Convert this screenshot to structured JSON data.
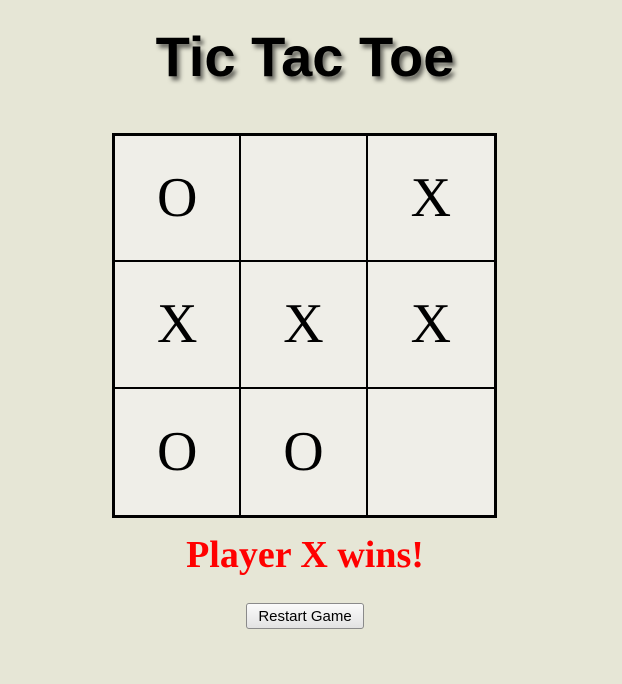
{
  "title": "Tic Tac Toe",
  "board": [
    [
      "O",
      "",
      "X"
    ],
    [
      "X",
      "X",
      "X"
    ],
    [
      "O",
      "O",
      ""
    ]
  ],
  "status": {
    "text": "Player X wins!",
    "color": "#ff0000"
  },
  "restart_label": "Restart Game"
}
